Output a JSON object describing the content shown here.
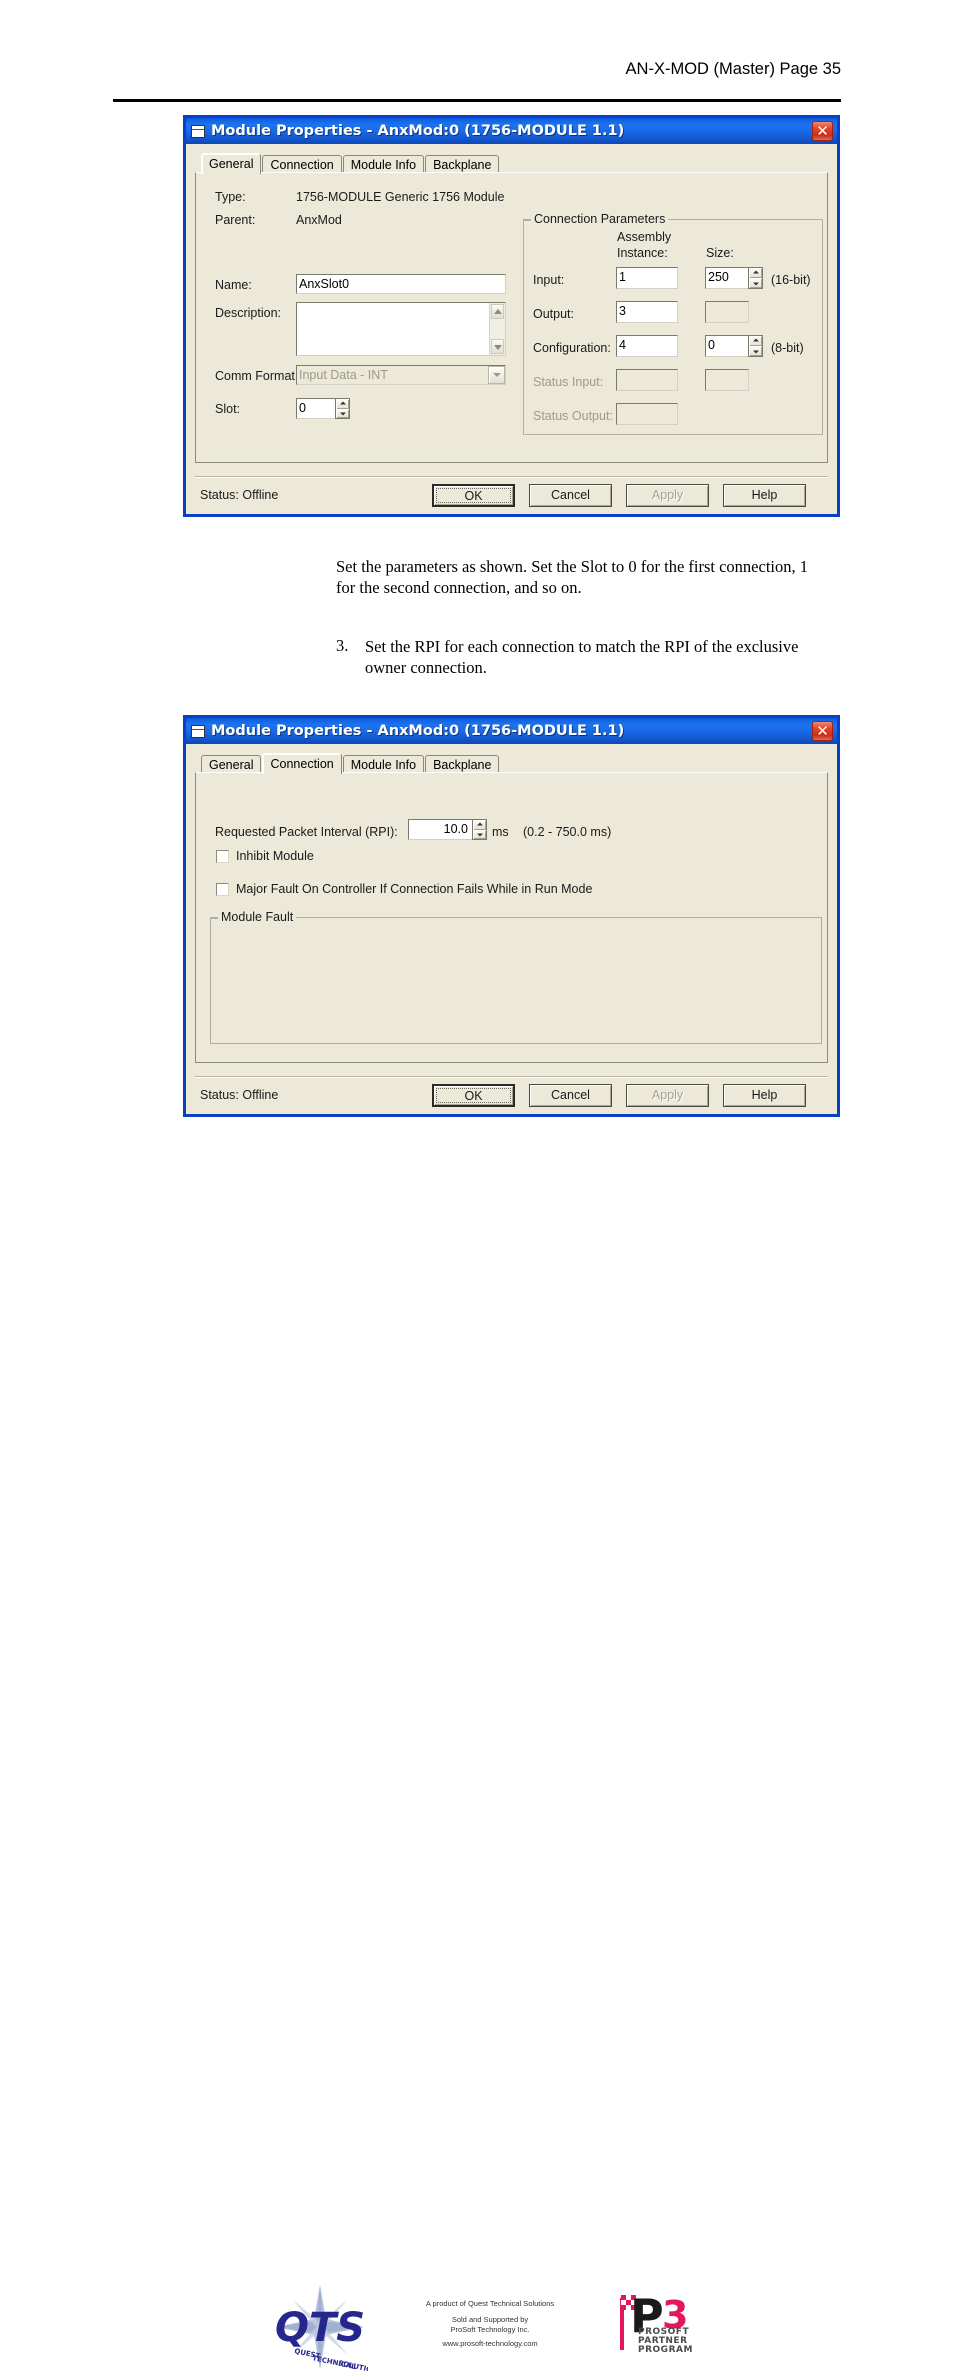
{
  "header": {
    "title": "AN-X-MOD (Master) Page 35"
  },
  "dialog1": {
    "title": "Module Properties  - AnxMod:0 (1756-MODULE 1.1)",
    "close_label": "✕",
    "tabs": [
      {
        "label": "General",
        "active": true
      },
      {
        "label": "Connection",
        "active": false
      },
      {
        "label": "Module Info",
        "active": false
      },
      {
        "label": "Backplane",
        "active": false
      }
    ],
    "fields": {
      "type_label": "Type:",
      "type_value": "1756-MODULE Generic 1756 Module",
      "parent_label": "Parent:",
      "parent_value": "AnxMod",
      "name_label": "Name:",
      "name_value": "AnxSlot0",
      "description_label": "Description:",
      "description_value": "",
      "comm_format_label": "Comm Format:",
      "comm_format_value": "Input Data - INT",
      "slot_label": "Slot:",
      "slot_value": "0"
    },
    "connection_parameters": {
      "legend": "Connection Parameters",
      "col_assembly_1": "Assembly",
      "col_assembly_2": "Instance:",
      "col_size": "Size:",
      "rows": [
        {
          "label": "Input:",
          "instance": "1",
          "size": "250",
          "unit": "(16-bit)",
          "disabled": false,
          "has_spinner": true,
          "size_enabled": true
        },
        {
          "label": "Output:",
          "instance": "3",
          "size": "",
          "unit": "",
          "disabled": false,
          "has_spinner": false,
          "size_enabled": false
        },
        {
          "label": "Configuration:",
          "instance": "4",
          "size": "0",
          "unit": "(8-bit)",
          "disabled": false,
          "has_spinner": true,
          "size_enabled": true
        },
        {
          "label": "Status Input:",
          "instance": "",
          "size": "",
          "unit": "",
          "disabled": true,
          "has_spinner": false,
          "size_enabled": false
        },
        {
          "label": "Status Output:",
          "instance": "",
          "size": "",
          "unit": "",
          "disabled": true,
          "has_spinner": false,
          "size_enabled": false
        }
      ]
    },
    "footer": {
      "status": "Status:  Offline",
      "ok": "OK",
      "cancel": "Cancel",
      "apply": "Apply",
      "help": "Help"
    }
  },
  "body": {
    "paragraph_1_line_1": "Set the parameters as shown.  Set the Slot to 0 for the first connection, 1",
    "paragraph_1_line_2": "for the second connection, and so on.",
    "item_number": "3.",
    "paragraph_2_line_1": "Set the RPI for each connection to match the RPI of the exclusive",
    "paragraph_2_line_2": "owner connection."
  },
  "dialog2": {
    "title": "Module Properties  - AnxMod:0 (1756-MODULE 1.1)",
    "close_label": "✕",
    "tabs": [
      {
        "label": "General",
        "active": false
      },
      {
        "label": "Connection",
        "active": true
      },
      {
        "label": "Module Info",
        "active": false
      },
      {
        "label": "Backplane",
        "active": false
      }
    ],
    "connection": {
      "rpi_label": "Requested Packet Interval (RPI):",
      "rpi_value": "10.0",
      "rpi_unit": "ms",
      "rpi_range": "(0.2 - 750.0 ms)",
      "inhibit_label": "Inhibit Module",
      "inhibit_checked": false,
      "major_fault_label": "Major Fault On Controller If Connection Fails While in Run Mode",
      "major_fault_checked": false,
      "module_fault_legend": "Module Fault",
      "module_fault_text": ""
    },
    "footer": {
      "status": "Status:  Offline",
      "ok": "OK",
      "cancel": "Cancel",
      "apply": "Apply",
      "help": "Help"
    }
  },
  "footer": {
    "line1": "A product of Quest Technical Solutions",
    "line2": "Sold and Supported by",
    "line3": "ProSoft Technology Inc.",
    "line4": "www.prosoft-technology.com",
    "qts_logo_text": "QTS",
    "qts_tag1": "Quest",
    "qts_tag2": "Technical",
    "qts_tag3": "Solutions",
    "p3_logo_text": "P3",
    "p3_line1": "PROSOFT",
    "p3_line2": "PARTNER",
    "p3_line3": "PROGRAM"
  },
  "colors": {
    "title_blue": "#1364e4",
    "dialog_border": "#0a3fc8",
    "face": "#ece9d8",
    "close_red": "#e2452a",
    "qts_navy": "#26268c",
    "p3_red": "#e4175c"
  }
}
